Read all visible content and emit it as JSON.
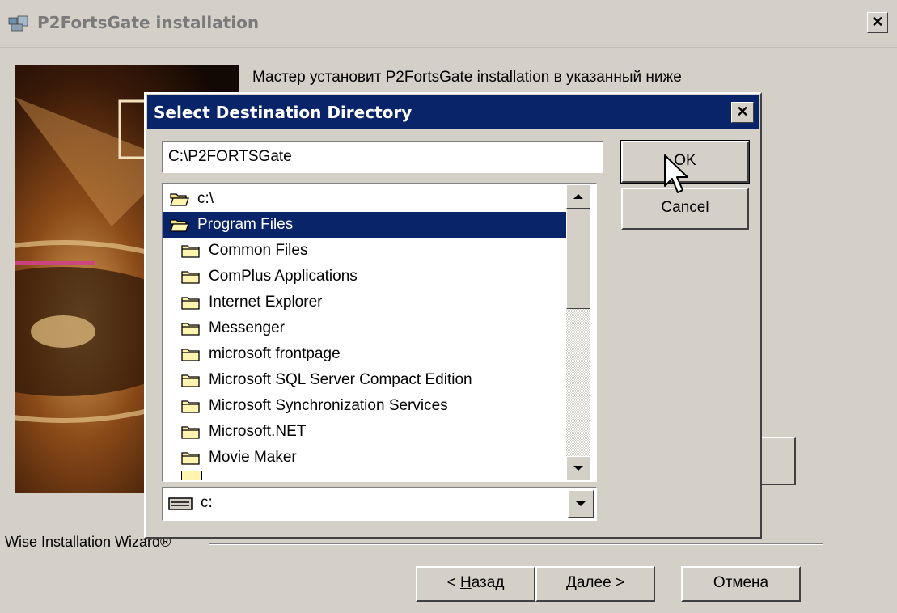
{
  "window": {
    "title": "P2FortsGate installation",
    "intro_text": "Мастер установит P2FortsGate installation в указанный ниже",
    "brand": "Wise Installation Wizard®",
    "buttons": {
      "back_prefix": "< ",
      "back_access": "Н",
      "back_rest": "азад",
      "next_access": "Д",
      "next_rest": "алее >",
      "cancel": "Отмена"
    }
  },
  "dialog": {
    "title": "Select Destination Directory",
    "path_value": "C:\\P2FORTSGate",
    "ok_label": "OK",
    "cancel_label": "Cancel",
    "folders": [
      {
        "label": "c:\\",
        "level": 0,
        "icon": "open-folder-icon",
        "selected": false
      },
      {
        "label": "Program Files",
        "level": 0,
        "icon": "open-folder-icon",
        "selected": true
      },
      {
        "label": "Common Files",
        "level": 1,
        "icon": "folder-icon",
        "selected": false
      },
      {
        "label": "ComPlus Applications",
        "level": 1,
        "icon": "folder-icon",
        "selected": false
      },
      {
        "label": "Internet Explorer",
        "level": 1,
        "icon": "folder-icon",
        "selected": false
      },
      {
        "label": "Messenger",
        "level": 1,
        "icon": "folder-icon",
        "selected": false
      },
      {
        "label": "microsoft frontpage",
        "level": 1,
        "icon": "folder-icon",
        "selected": false
      },
      {
        "label": "Microsoft SQL Server Compact Edition",
        "level": 1,
        "icon": "folder-icon",
        "selected": false
      },
      {
        "label": "Microsoft Synchronization Services",
        "level": 1,
        "icon": "folder-icon",
        "selected": false
      },
      {
        "label": "Microsoft.NET",
        "level": 1,
        "icon": "folder-icon",
        "selected": false
      },
      {
        "label": "Movie Maker",
        "level": 1,
        "icon": "folder-icon",
        "selected": false
      }
    ],
    "drive": "c:",
    "colors": {
      "title_bar": "#0a246a",
      "selection": "#0a246a",
      "face": "#d4d0c8"
    }
  }
}
